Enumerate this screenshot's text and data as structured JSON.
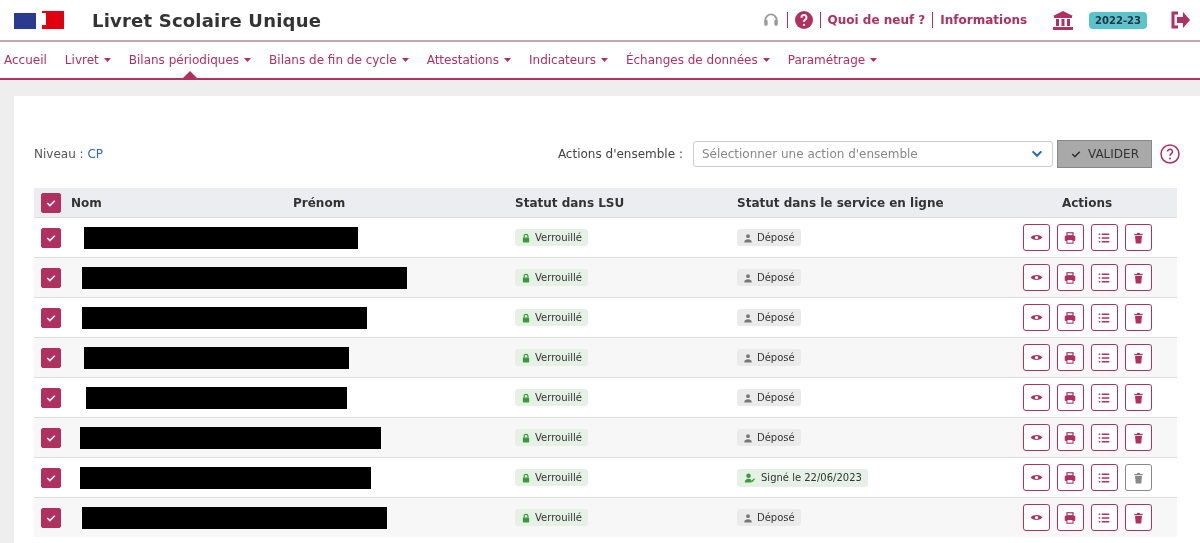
{
  "header": {
    "title": "Livret Scolaire Unique",
    "links": [
      "Quoi de neuf ?",
      "Informations"
    ],
    "year_badge": "2022-23"
  },
  "nav": [
    {
      "label": "Accueil",
      "dropdown": false,
      "selected": false
    },
    {
      "label": "Livret",
      "dropdown": true,
      "selected": false
    },
    {
      "label": "Bilans périodiques",
      "dropdown": true,
      "selected": true
    },
    {
      "label": "Bilans de fin de cycle",
      "dropdown": true,
      "selected": false
    },
    {
      "label": "Attestations",
      "dropdown": true,
      "selected": false
    },
    {
      "label": "Indicateurs",
      "dropdown": true,
      "selected": false
    },
    {
      "label": "Échanges de données",
      "dropdown": true,
      "selected": false
    },
    {
      "label": "Paramétrage",
      "dropdown": true,
      "selected": false
    }
  ],
  "level": {
    "label": "Niveau :",
    "value": "CP"
  },
  "bulk_actions": {
    "label": "Actions d'ensemble :",
    "placeholder": "Sélectionner une action d'ensemble",
    "button": "VALIDER"
  },
  "table": {
    "all_checked": true,
    "columns": [
      "Nom",
      "Prénom",
      "Statut dans LSU",
      "Statut dans le service en ligne",
      "Actions"
    ],
    "rows": [
      {
        "checked": true,
        "lsu_status": "Verrouillé",
        "kind": "deposited",
        "online_status": "Déposé",
        "delete_disabled": false
      },
      {
        "checked": true,
        "lsu_status": "Verrouillé",
        "kind": "deposited",
        "online_status": "Déposé",
        "delete_disabled": false
      },
      {
        "checked": true,
        "lsu_status": "Verrouillé",
        "kind": "deposited",
        "online_status": "Déposé",
        "delete_disabled": false
      },
      {
        "checked": true,
        "lsu_status": "Verrouillé",
        "kind": "deposited",
        "online_status": "Déposé",
        "delete_disabled": false
      },
      {
        "checked": true,
        "lsu_status": "Verrouillé",
        "kind": "deposited",
        "online_status": "Déposé",
        "delete_disabled": false
      },
      {
        "checked": true,
        "lsu_status": "Verrouillé",
        "kind": "deposited",
        "online_status": "Déposé",
        "delete_disabled": false
      },
      {
        "checked": true,
        "lsu_status": "Verrouillé",
        "kind": "signed",
        "online_status": "Signé le 22/06/2023",
        "delete_disabled": true
      },
      {
        "checked": true,
        "lsu_status": "Verrouillé",
        "kind": "deposited",
        "online_status": "Déposé",
        "delete_disabled": false
      }
    ]
  }
}
